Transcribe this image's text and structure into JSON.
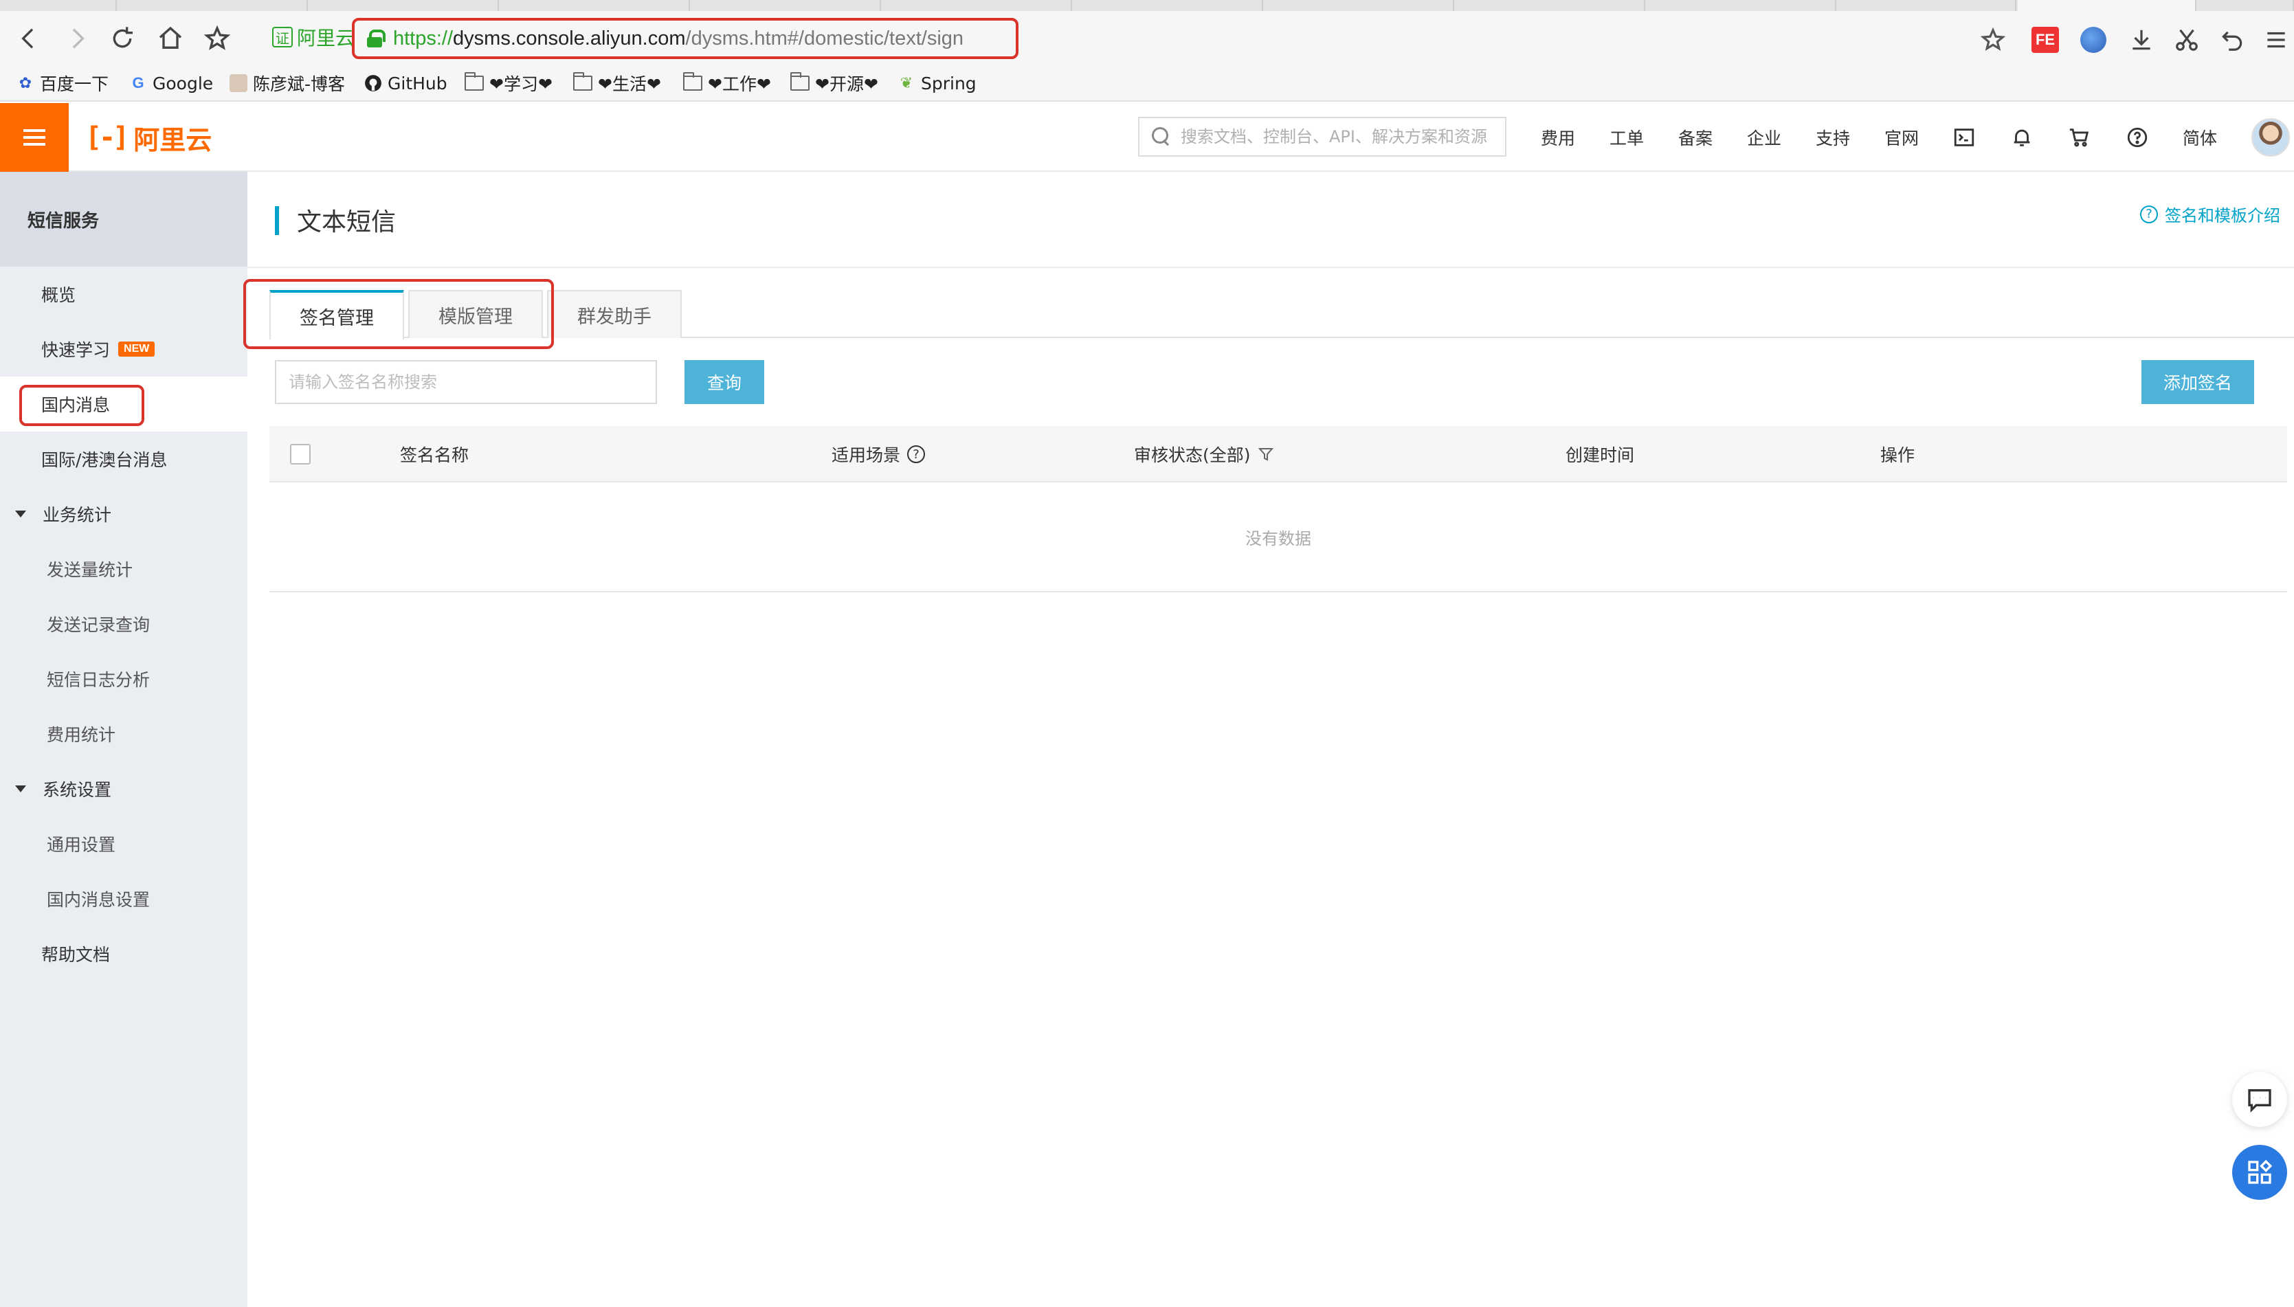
{
  "browser": {
    "url_scheme": "https://",
    "url_host": "dysms.console.aliyun.com",
    "url_path": "/dysms.htm#/domestic/text/sign",
    "site_badge": "阿里云",
    "bookmarks": [
      {
        "label": "百度一下",
        "icon": "baidu-paw-icon"
      },
      {
        "label": "Google",
        "icon": "google-g-icon"
      },
      {
        "label": "陈彦斌-博客",
        "icon": "blog-avatar-icon"
      },
      {
        "label": "GitHub",
        "icon": "github-icon"
      },
      {
        "label": "❤学习❤",
        "icon": "folder-icon"
      },
      {
        "label": "❤生活❤",
        "icon": "folder-icon"
      },
      {
        "label": "❤工作❤",
        "icon": "folder-icon"
      },
      {
        "label": "❤开源❤",
        "icon": "folder-icon"
      },
      {
        "label": "Spring",
        "icon": "spring-leaf-icon"
      }
    ],
    "extension_fe": "FE"
  },
  "header": {
    "logo_text": "阿里云",
    "search_placeholder": "搜索文档、控制台、API、解决方案和资源",
    "nav": [
      "费用",
      "工单",
      "备案",
      "企业",
      "支持",
      "官网"
    ],
    "lang": "简体",
    "accent": "#ff6a00"
  },
  "sidebar": {
    "title": "短信服务",
    "items": [
      {
        "label": "概览",
        "level": "l1"
      },
      {
        "label": "快速学习",
        "level": "l1",
        "badge": "NEW"
      },
      {
        "label": "国内消息",
        "level": "l1",
        "active": true
      },
      {
        "label": "国际/港澳台消息",
        "level": "l1"
      },
      {
        "label": "业务统计",
        "level": "group"
      },
      {
        "label": "发送量统计",
        "level": "l2"
      },
      {
        "label": "发送记录查询",
        "level": "l2"
      },
      {
        "label": "短信日志分析",
        "level": "l2"
      },
      {
        "label": "费用统计",
        "level": "l2"
      },
      {
        "label": "系统设置",
        "level": "group"
      },
      {
        "label": "通用设置",
        "level": "l2"
      },
      {
        "label": "国内消息设置",
        "level": "l2"
      },
      {
        "label": "帮助文档",
        "level": "l1"
      }
    ]
  },
  "main": {
    "page_title": "文本短信",
    "help_link": "签名和模板介绍",
    "tabs": [
      {
        "label": "签名管理",
        "active": true
      },
      {
        "label": "模版管理"
      },
      {
        "label": "群发助手"
      }
    ],
    "filter_placeholder": "请输入签名名称搜索",
    "query_button": "查询",
    "add_button": "添加签名",
    "table": {
      "columns": [
        "签名名称",
        "适用场景",
        "审核状态(全部)",
        "创建时间",
        "操作"
      ],
      "empty_text": "没有数据"
    },
    "primary_color": "#00a2ca",
    "highlight_color": "#d9342b"
  }
}
